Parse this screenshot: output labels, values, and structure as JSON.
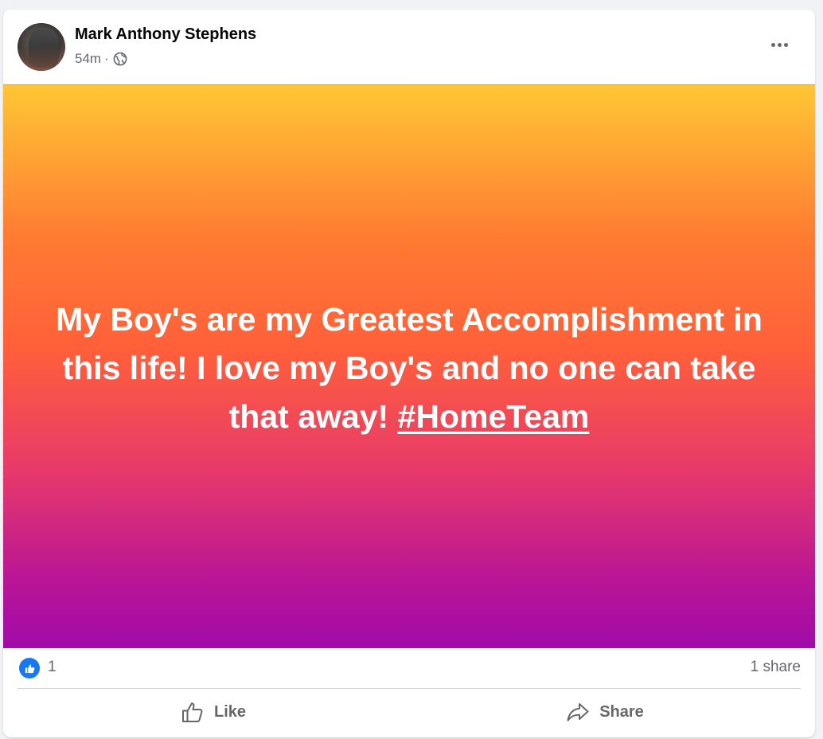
{
  "post": {
    "author": "Mark Anthony Stephens",
    "time": "54m",
    "separator": "·",
    "privacy_icon": "globe-icon",
    "more_icon": "more-options-icon",
    "background_gradient": [
      "#ffc634",
      "#ff7b32",
      "#ff5f3a",
      "#e83a6a",
      "#b91596",
      "#a10aaa"
    ],
    "text_before_hashtag": "My Boy's are my Greatest Accomplishment in this life! I love my Boy's and no one can take that away! ",
    "hashtag": "#HomeTeam",
    "text_color": "#ffffff"
  },
  "stats": {
    "reaction_icon": "like-reaction-icon",
    "reaction_count": "1",
    "share_count": "1 share"
  },
  "actions": {
    "like_label": "Like",
    "like_icon": "thumbs-up-icon",
    "share_label": "Share",
    "share_icon": "share-arrow-icon"
  },
  "colors": {
    "accent": "#1877f2",
    "secondary_text": "#65676b",
    "primary_text": "#050505"
  }
}
